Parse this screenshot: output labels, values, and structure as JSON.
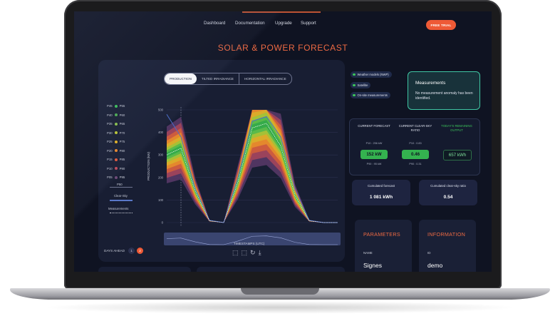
{
  "nav": {
    "links": [
      "Dashboard",
      "Documentation",
      "Upgrade",
      "Support"
    ],
    "trial_button": "FREE TRIAL"
  },
  "page": {
    "title": "SOLAR & POWER FORECAST"
  },
  "tabs": [
    "PRODUCTION",
    "TILTED IRRADIANCE",
    "HORIZONTAL IRRADIANCE"
  ],
  "legend": {
    "rows": [
      [
        "P45",
        "P55"
      ],
      [
        "P40",
        "P60"
      ],
      [
        "P35",
        "P65"
      ],
      [
        "P30",
        "P70"
      ],
      [
        "P25",
        "P75"
      ],
      [
        "P20",
        "P80"
      ],
      [
        "P15",
        "P85"
      ],
      [
        "P10",
        "P90"
      ],
      [
        "P05",
        "P95"
      ]
    ],
    "colors": [
      "#3cc45a",
      "#4caf50",
      "#8bc34a",
      "#c0ca33",
      "#e6b422",
      "#ef8a2a",
      "#e85a3a",
      "#c24a5a",
      "#6e4a78"
    ],
    "p50": "P50",
    "clear_sky": "Clear-Sky",
    "measurements": "Measurements"
  },
  "chart_data": {
    "type": "area",
    "ylabel": "PRODUCTION (kW)",
    "xlabel": "TIMESTAMPS (UTC)",
    "ylim": [
      0,
      500
    ],
    "yticks": [
      "500",
      "400",
      "300",
      "200",
      "100",
      "0"
    ],
    "series": [
      {
        "name": "Clear-Sky",
        "x": [
          0,
          4,
          8,
          12,
          16,
          20,
          24,
          28,
          32,
          36,
          40,
          44,
          48
        ],
        "values": [
          480,
          380,
          150,
          10,
          0,
          200,
          450,
          470,
          380,
          150,
          10,
          0,
          0
        ]
      },
      {
        "name": "P50",
        "x": [
          0,
          4,
          8,
          12,
          16,
          20,
          24,
          28,
          32,
          36,
          40,
          44,
          48
        ],
        "values": [
          300,
          330,
          140,
          8,
          0,
          180,
          420,
          440,
          340,
          120,
          8,
          0,
          0
        ]
      }
    ],
    "grid": true
  },
  "footer": {
    "days_ahead": "DAYS AHEAD",
    "days": [
      "1",
      "2"
    ]
  },
  "sources": [
    "Weather models (NWP)",
    "Satellite",
    "On-site measurements"
  ],
  "measurements_card": {
    "title": "Measurements",
    "text": "No measurement anomaly has been identified."
  },
  "forecast": {
    "columns": [
      {
        "head": "CURRENT FORECAST",
        "top": "P10 : 256 kW",
        "value": "152 kW",
        "bottom": "P90 : 95 kW"
      },
      {
        "head": "CURRENT CLEAR-SKY RATIO",
        "top": "P10 : 0.83",
        "value": "0.46",
        "bottom": "P90 : 0.31"
      },
      {
        "head": "TODAY'S REMAINING OUTPUT",
        "top": "",
        "value": "657 kWh",
        "bottom": ""
      }
    ]
  },
  "summary": [
    {
      "title": "Cumulated forecast",
      "value": "1 081 kWh"
    },
    {
      "title": "Cumulated clear-sky ratio",
      "value": "0.54"
    }
  ],
  "parameters": {
    "title": "PARAMETERS",
    "label": "NAME",
    "value": "Signes"
  },
  "information": {
    "title": "INFORMATION",
    "label": "ID",
    "value": "demo"
  }
}
